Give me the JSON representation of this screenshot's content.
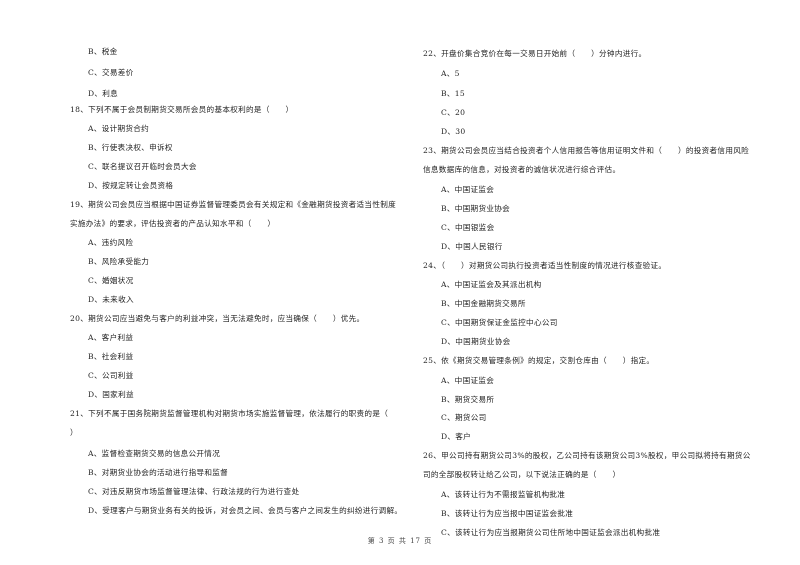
{
  "left_column": {
    "lines": [
      {
        "kind": "opt",
        "text": "B、税金"
      },
      {
        "kind": "opt",
        "text": "C、交易差价"
      },
      {
        "kind": "opt",
        "text": "D、利息"
      },
      {
        "kind": "q",
        "text": "18、下列不属于会员制期货交易所会员的基本权利的是（　　）"
      },
      {
        "kind": "opt",
        "text": "A、设计期货合约"
      },
      {
        "kind": "opt",
        "text": "B、行使表决权、申诉权"
      },
      {
        "kind": "opt",
        "text": "C、联名提议召开临时会员大会"
      },
      {
        "kind": "opt",
        "text": "D、按规定转让会员资格"
      },
      {
        "kind": "q",
        "text": "19、期货公司会员应当根据中国证券监督管理委员会有关规定和《金融期货投资者适当性制度"
      },
      {
        "kind": "q",
        "text": "实施办法》的要求，评估投资者的产品认知水平和（　　）"
      },
      {
        "kind": "opt",
        "text": "A、违约风险"
      },
      {
        "kind": "opt",
        "text": "B、风险承受能力"
      },
      {
        "kind": "opt",
        "text": "C、婚姻状况"
      },
      {
        "kind": "opt",
        "text": "D、未来收入"
      },
      {
        "kind": "q",
        "text": "20、期货公司应当避免与客户的利益冲突，当无法避免时，应当确保（　　）优先。"
      },
      {
        "kind": "opt",
        "text": "A、客户利益"
      },
      {
        "kind": "opt",
        "text": "B、社会利益"
      },
      {
        "kind": "opt",
        "text": "C、公司利益"
      },
      {
        "kind": "opt",
        "text": "D、国家利益"
      },
      {
        "kind": "q",
        "text": "21、下列不属于国务院期货监督管理机构对期货市场实施监督管理，依法履行的职责的是（"
      },
      {
        "kind": "q",
        "text": "）"
      },
      {
        "kind": "opt",
        "text": "A、监督检查期货交易的信息公开情况"
      },
      {
        "kind": "opt",
        "text": "B、对期货业协会的活动进行指导和监督"
      },
      {
        "kind": "opt",
        "text": "C、对违反期货市场监督管理法律、行政法规的行为进行查处"
      },
      {
        "kind": "opt",
        "text": "D、受理客户与期货业务有关的投诉，对会员之间、会员与客户之间发生的纠纷进行调解。"
      }
    ]
  },
  "right_column": {
    "lines": [
      {
        "kind": "q",
        "text": "22、开盘价集合竞价在每一交易日开始前（　　）分钟内进行。"
      },
      {
        "kind": "opt",
        "text": "A、5"
      },
      {
        "kind": "opt",
        "text": "B、15"
      },
      {
        "kind": "opt",
        "text": "C、20"
      },
      {
        "kind": "opt",
        "text": "D、30"
      },
      {
        "kind": "q",
        "text": "23、期货公司会员应当结合投资者个人信用报告等信用证明文件和（　　）的投资者信用风险"
      },
      {
        "kind": "q",
        "text": "信息数据库的信息，对投资者的诚信状况进行综合评估。"
      },
      {
        "kind": "opt",
        "text": "A、中国证监会"
      },
      {
        "kind": "opt",
        "text": "B、中国期货业协会"
      },
      {
        "kind": "opt",
        "text": "C、中国银监会"
      },
      {
        "kind": "opt",
        "text": "D、中国人民银行"
      },
      {
        "kind": "q",
        "text": "24、（　　）对期货公司执行投资者适当性制度的情况进行核查验证。"
      },
      {
        "kind": "opt",
        "text": "A、中国证监会及其派出机构"
      },
      {
        "kind": "opt",
        "text": "B、中国金融期货交易所"
      },
      {
        "kind": "opt",
        "text": "C、中国期货保证金监控中心公司"
      },
      {
        "kind": "opt",
        "text": "D、中国期货业协会"
      },
      {
        "kind": "q",
        "text": "25、依《期货交易管理条例》的规定，交割仓库由（　　）指定。"
      },
      {
        "kind": "opt",
        "text": "A、中国证监会"
      },
      {
        "kind": "opt",
        "text": "B、期货交易所"
      },
      {
        "kind": "opt",
        "text": "C、期货公司"
      },
      {
        "kind": "opt",
        "text": "D、客户"
      },
      {
        "kind": "q",
        "text": "26、甲公司持有期货公司3%的股权，乙公司持有该期货公司3%股权，甲公司拟将持有期货公"
      },
      {
        "kind": "q",
        "text": "司的全部股权转让给乙公司，以下说法正确的是（　　）"
      },
      {
        "kind": "opt",
        "text": "A、该转让行为不需报监管机构批准"
      },
      {
        "kind": "opt",
        "text": "B、该转让行为应当报中国证监会批准"
      },
      {
        "kind": "opt",
        "text": "C、该转让行为应当报期货公司住所地中国证监会派出机构批准"
      }
    ]
  },
  "footer": {
    "page_label": "第 3 页 共 17 页"
  }
}
